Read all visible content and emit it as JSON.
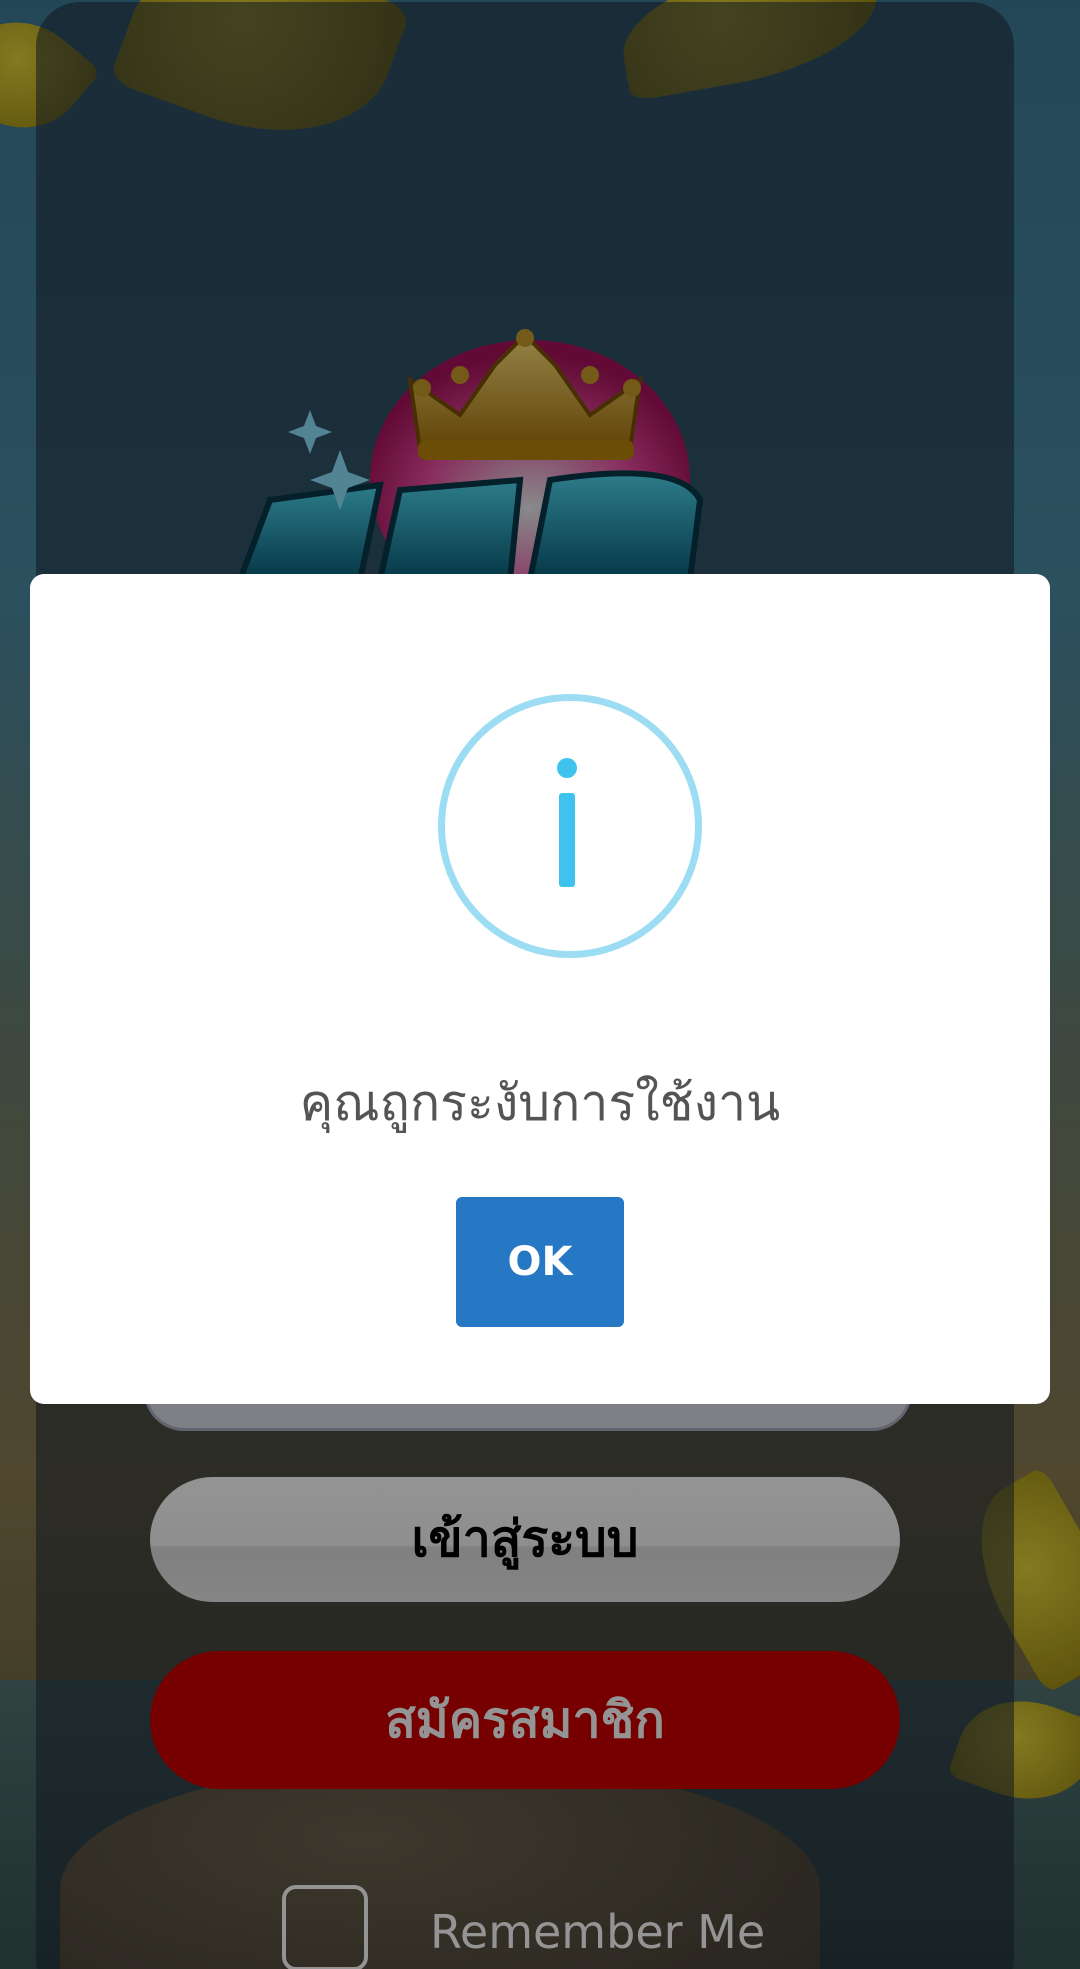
{
  "login": {
    "login_button_label": "เข้าสู่ระบบ",
    "register_button_label": "สมัครสมาชิก",
    "remember_label": "Remember Me"
  },
  "dialog": {
    "icon": "info-icon",
    "message": "คุณถูกระงับการใช้งาน",
    "ok_label": "OK"
  },
  "colors": {
    "ok_button": "#2778c4",
    "info_icon": "#3fc3ee",
    "register_button": "#cc0000"
  }
}
